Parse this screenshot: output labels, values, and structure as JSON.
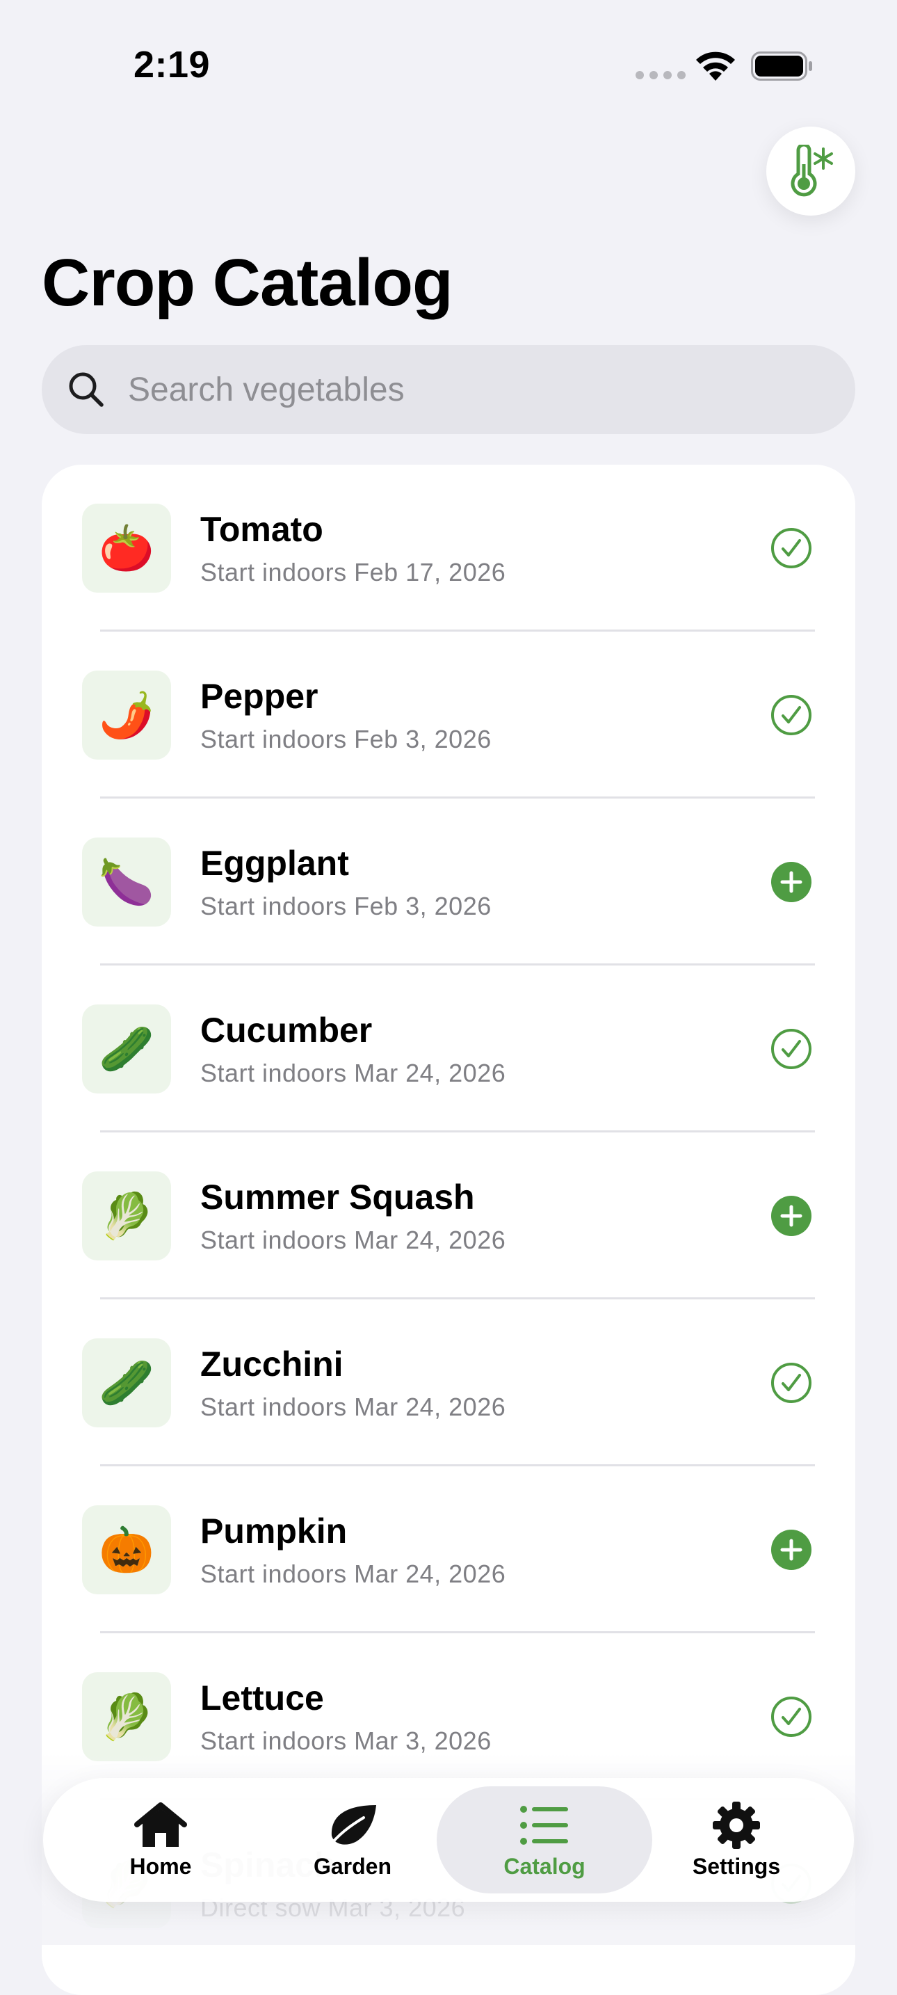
{
  "status": {
    "time": "2:19"
  },
  "header": {
    "title": "Crop Catalog",
    "top_button_icon": "thermometer-snowflake-icon"
  },
  "search": {
    "placeholder": "Search vegetables",
    "value": ""
  },
  "accent_color": "#4f9c43",
  "crops": [
    {
      "emoji": "🍅",
      "name": "Tomato",
      "subtitle": "Start indoors Feb 17, 2026",
      "status": "added"
    },
    {
      "emoji": "🌶️",
      "name": "Pepper",
      "subtitle": "Start indoors Feb 3, 2026",
      "status": "added"
    },
    {
      "emoji": "🍆",
      "name": "Eggplant",
      "subtitle": "Start indoors Feb 3, 2026",
      "status": "add"
    },
    {
      "emoji": "🥒",
      "name": "Cucumber",
      "subtitle": "Start indoors Mar 24, 2026",
      "status": "added"
    },
    {
      "emoji": "🥬",
      "name": "Summer Squash",
      "subtitle": "Start indoors Mar 24, 2026",
      "status": "add"
    },
    {
      "emoji": "🥒",
      "name": "Zucchini",
      "subtitle": "Start indoors Mar 24, 2026",
      "status": "added"
    },
    {
      "emoji": "🎃",
      "name": "Pumpkin",
      "subtitle": "Start indoors Mar 24, 2026",
      "status": "add"
    },
    {
      "emoji": "🥬",
      "name": "Lettuce",
      "subtitle": "Start indoors Mar 3, 2026",
      "status": "added"
    },
    {
      "emoji": "🥬",
      "name": "Spinach",
      "subtitle": "Direct sow Mar 3, 2026",
      "status": "added"
    }
  ],
  "tabbar": {
    "tabs": [
      {
        "label": "Home",
        "icon": "house-icon"
      },
      {
        "label": "Garden",
        "icon": "leaf-icon"
      },
      {
        "label": "Catalog",
        "icon": "list-icon",
        "selected": true
      },
      {
        "label": "Settings",
        "icon": "gear-icon"
      }
    ]
  }
}
